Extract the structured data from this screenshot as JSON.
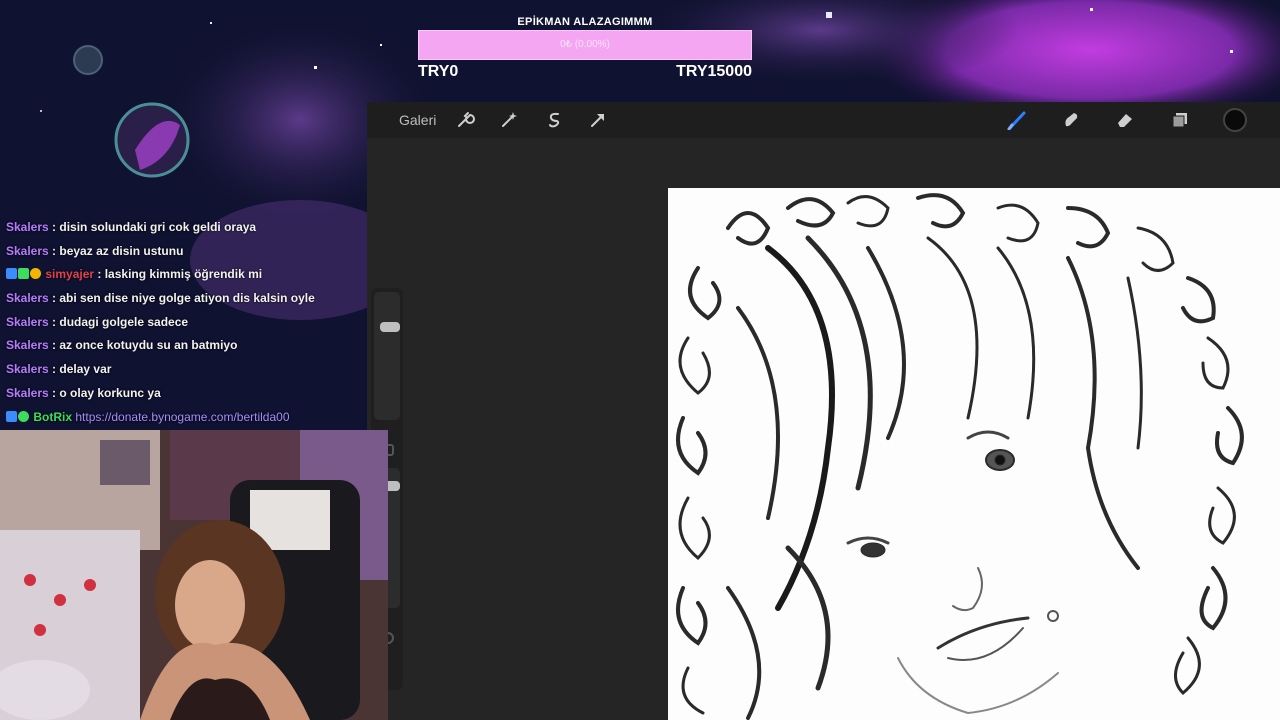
{
  "goal": {
    "title": "EPİKMAN ALAZAGIMMM",
    "progress_text": "0₺ (0.00%)",
    "progress_fraction": 0.0,
    "start_label": "TRY0",
    "end_label": "TRY15000"
  },
  "procreate": {
    "gallery_label": "Galeri",
    "left_tools": [
      "wrench-icon",
      "magic-wand-icon",
      "selection-icon",
      "transform-arrow-icon"
    ],
    "right_tools": [
      "brush-icon",
      "smudge-icon",
      "eraser-icon",
      "layers-icon"
    ],
    "current_color": "#0a0a0a",
    "brush_size_level": 0.75,
    "opacity_level": 0.9
  },
  "chat": [
    {
      "user": "Skalers",
      "color": "#b67cff",
      "badges": [],
      "message": ": disin solundaki gri cok geldi oraya"
    },
    {
      "user": "Skalers",
      "color": "#b67cff",
      "badges": [],
      "message": ": beyaz az disin ustunu"
    },
    {
      "user": "simyajer",
      "color": "#e0404f",
      "badges": [
        "prime-badge",
        "sparkle-badge",
        "number-1-badge"
      ],
      "message": ": lasking kimmiş öğrendik mi"
    },
    {
      "user": "Skalers",
      "color": "#b67cff",
      "badges": [],
      "message": ": abi sen dise niye golge atiyon dis kalsin oyle"
    },
    {
      "user": "Skalers",
      "color": "#b67cff",
      "badges": [],
      "message": ": dudagi golgele sadece"
    },
    {
      "user": "Skalers",
      "color": "#b67cff",
      "badges": [],
      "message": ": az once kotuydu su an batmiyo"
    },
    {
      "user": "Skalers",
      "color": "#b67cff",
      "badges": [],
      "message": ": delay var"
    },
    {
      "user": "Skalers",
      "color": "#b67cff",
      "badges": [],
      "message": ": o olay korkunc ya"
    },
    {
      "user": "BotRix",
      "color": "#3ddc5c",
      "badges": [
        "prime-badge",
        "verified-badge"
      ],
      "message": "",
      "link": "https://donate.bynogame.com/bertilda00"
    }
  ],
  "colors": {
    "accent_pink": "#f4a6f3",
    "toolbar": "#1e1e1e",
    "brush_active": "#2f7dff"
  }
}
